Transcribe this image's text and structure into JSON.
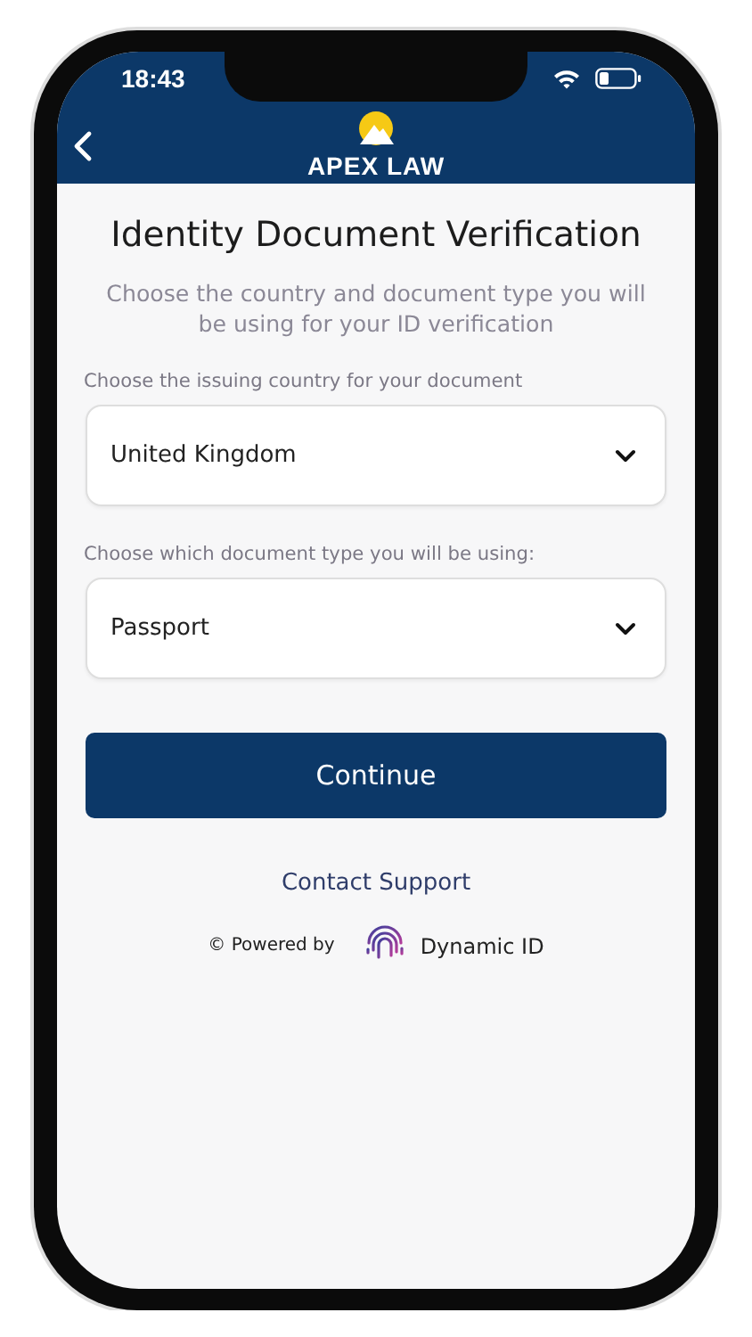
{
  "status_bar": {
    "time": "18:43"
  },
  "header": {
    "logo_text": "APEX LAW"
  },
  "title": "Identity Document Verification",
  "subtitle": "Choose the country and document type you will be using for your ID verification",
  "fields": [
    {
      "label": "Choose the issuing country for your document",
      "value": "United Kingdom"
    },
    {
      "label": "Choose which document type you will be using:",
      "value": "Passport"
    }
  ],
  "button": "Continue",
  "link": "Contact Support",
  "footer": {
    "powered_by": "© Powered by",
    "brand": "Dynamic ID"
  }
}
